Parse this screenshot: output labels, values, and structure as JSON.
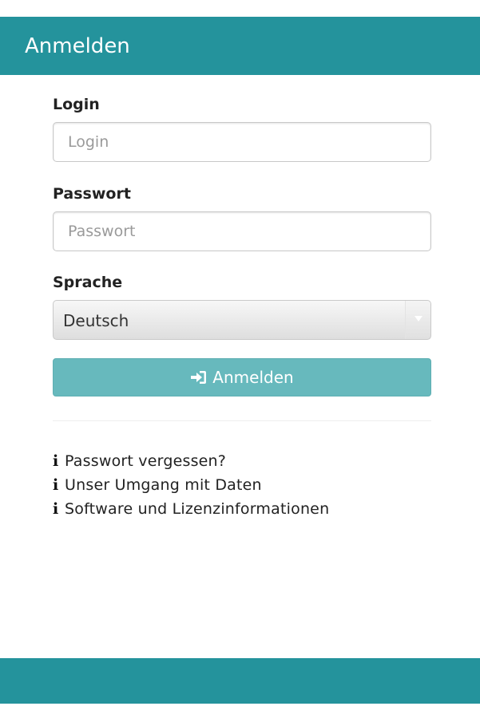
{
  "header": {
    "title": "Anmelden"
  },
  "form": {
    "login": {
      "label": "Login",
      "placeholder": "Login",
      "value": ""
    },
    "password": {
      "label": "Passwort",
      "placeholder": "Passwort",
      "value": ""
    },
    "language": {
      "label": "Sprache",
      "selected": "Deutsch"
    },
    "submit": {
      "label": "Anmelden",
      "icon": "sign-in-icon"
    }
  },
  "links": [
    {
      "icon": "info-icon",
      "label": "Passwort vergessen?"
    },
    {
      "icon": "info-icon",
      "label": "Unser Umgang mit Daten"
    },
    {
      "icon": "info-icon",
      "label": "Software und Lizenzinformationen"
    }
  ],
  "colors": {
    "brand": "#24939c",
    "button": "#67b9bd"
  }
}
